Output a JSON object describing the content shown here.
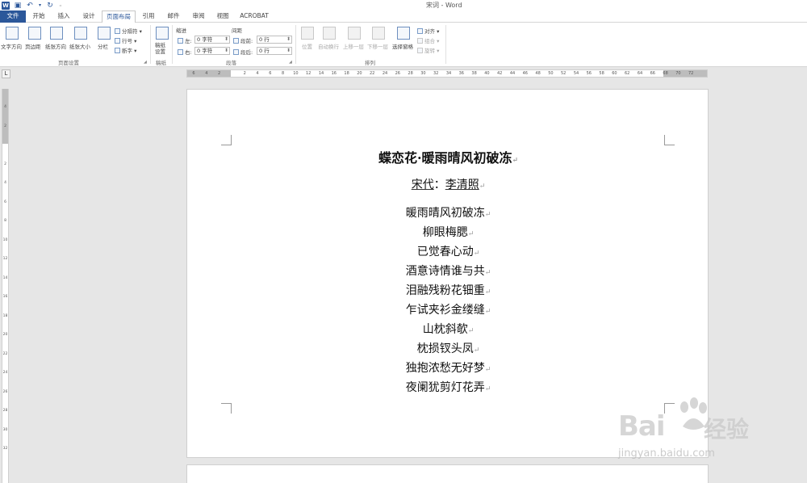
{
  "window": {
    "title": "宋词 - Word"
  },
  "tabs": [
    "文件",
    "开始",
    "插入",
    "设计",
    "页面布局",
    "引用",
    "邮件",
    "审阅",
    "视图",
    "ACROBAT"
  ],
  "ribbon": {
    "page_setup": {
      "text_direction": "文字方向",
      "margins": "页边距",
      "orientation": "纸张方向",
      "size": "纸张大小",
      "columns": "分栏",
      "breaks": "分隔符",
      "line_numbers": "行号",
      "hyphenation": "断字",
      "group_label": "页面设置"
    },
    "draft": {
      "button": "稿纸设置",
      "group_label": "稿纸"
    },
    "paragraph": {
      "indent_label": "缩进",
      "spacing_label": "间距",
      "left_label": "左:",
      "right_label": "右:",
      "before_label": "段前:",
      "after_label": "段后:",
      "left_value": "0 字符",
      "right_value": "0 字符",
      "before_value": "0 行",
      "after_value": "0 行",
      "group_label": "段落"
    },
    "arrange": {
      "position": "位置",
      "wrap_text": "自动换行",
      "bring_forward": "上移一层",
      "send_backward": "下移一层",
      "selection_pane": "选择窗格",
      "align": "对齐",
      "group": "组合",
      "rotate": "旋转",
      "group_label": "排列"
    }
  },
  "ruler": {
    "corner": "L",
    "h_ticks": [
      "6",
      "4",
      "2",
      "",
      "2",
      "4",
      "6",
      "8",
      "10",
      "12",
      "14",
      "16",
      "18",
      "20",
      "22",
      "24",
      "26",
      "28",
      "30",
      "32",
      "34",
      "36",
      "38",
      "40",
      "42",
      "44",
      "46",
      "48",
      "50",
      "52",
      "54",
      "56",
      "58",
      "60",
      "62",
      "64",
      "66",
      "68",
      "70",
      "72"
    ],
    "v_ticks": [
      "4",
      "2",
      "",
      "2",
      "4",
      "6",
      "8",
      "10",
      "12",
      "14",
      "16",
      "18",
      "20",
      "22",
      "24",
      "26",
      "28",
      "30",
      "32"
    ]
  },
  "document": {
    "title": "蝶恋花·暖雨晴风初破冻",
    "author_prefix": "宋代",
    "author_sep": "：",
    "author_name": "李清照",
    "verses": [
      "暖雨晴风初破冻",
      "柳眼梅腮",
      "已觉春心动",
      "酒意诗情谁与共",
      "泪融残粉花钿重",
      "乍试夹衫金缕缝",
      "山枕斜欹",
      "枕损钗头凤",
      "独抱浓愁无好梦",
      "夜阑犹剪灯花弄"
    ],
    "paragraph_mark": "↵"
  },
  "watermark": {
    "brand": "Bai",
    "suffix": "经验",
    "url": "jingyan.baidu.com"
  }
}
